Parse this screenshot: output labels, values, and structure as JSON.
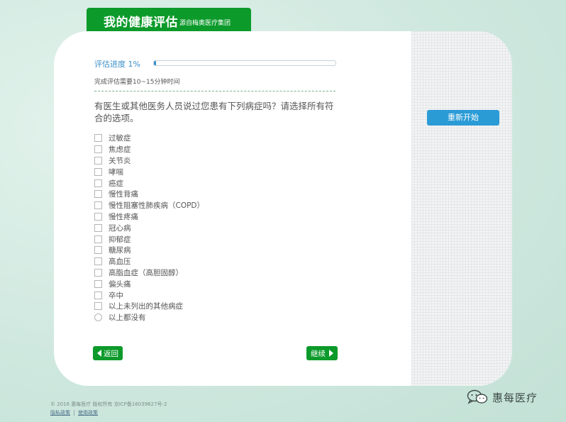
{
  "header": {
    "title": "我的健康评估",
    "subtitle": "源自梅奥医疗集团"
  },
  "progress": {
    "label": "评估进度 1%",
    "value": 0.01,
    "time_note": "完成评估需要10~15分钟时间"
  },
  "question": "有医生或其他医务人员说过您患有下列病症吗？请选择所有符合的选项。",
  "options": [
    {
      "label": "过敏症",
      "type": "checkbox",
      "checked": false
    },
    {
      "label": "焦虑症",
      "type": "checkbox",
      "checked": false
    },
    {
      "label": "关节炎",
      "type": "checkbox",
      "checked": false
    },
    {
      "label": "哮喘",
      "type": "checkbox",
      "checked": false
    },
    {
      "label": "癌症",
      "type": "checkbox",
      "checked": false
    },
    {
      "label": "慢性背痛",
      "type": "checkbox",
      "checked": false
    },
    {
      "label": "慢性阻塞性肺疾病（COPD）",
      "type": "checkbox",
      "checked": false
    },
    {
      "label": "慢性疼痛",
      "type": "checkbox",
      "checked": false
    },
    {
      "label": "冠心病",
      "type": "checkbox",
      "checked": false
    },
    {
      "label": "抑郁症",
      "type": "checkbox",
      "checked": false
    },
    {
      "label": "糖尿病",
      "type": "checkbox",
      "checked": false
    },
    {
      "label": "高血压",
      "type": "checkbox",
      "checked": false
    },
    {
      "label": "高脂血症（高胆固醇）",
      "type": "checkbox",
      "checked": false
    },
    {
      "label": "偏头痛",
      "type": "checkbox",
      "checked": false
    },
    {
      "label": "卒中",
      "type": "checkbox",
      "checked": false
    },
    {
      "label": "以上未列出的其他病症",
      "type": "checkbox",
      "checked": false
    },
    {
      "label": "以上都没有",
      "type": "radio",
      "checked": false
    }
  ],
  "buttons": {
    "back": "返回",
    "next": "继续",
    "restart": "重新开始"
  },
  "footer": {
    "copyright": "© 2016 惠每医疗 版权所有 京ICP备16039627号-2",
    "links": [
      "隐私政策",
      "使用政策"
    ]
  },
  "watermark": "惠每医疗",
  "colors": {
    "brand_green": "#0c9a2a",
    "progress_blue": "#3a8fc8",
    "restart_blue": "#2b9bd6"
  }
}
